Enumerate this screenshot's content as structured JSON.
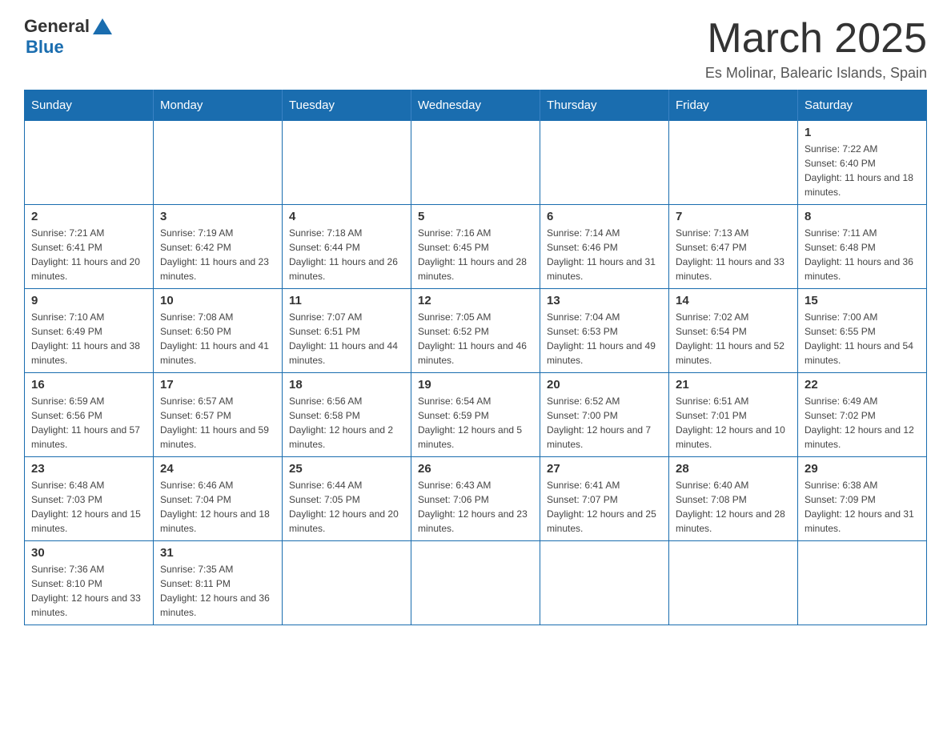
{
  "logo": {
    "general": "General",
    "blue": "Blue"
  },
  "header": {
    "title": "March 2025",
    "location": "Es Molinar, Balearic Islands, Spain"
  },
  "weekdays": [
    "Sunday",
    "Monday",
    "Tuesday",
    "Wednesday",
    "Thursday",
    "Friday",
    "Saturday"
  ],
  "weeks": [
    [
      {
        "day": "",
        "info": ""
      },
      {
        "day": "",
        "info": ""
      },
      {
        "day": "",
        "info": ""
      },
      {
        "day": "",
        "info": ""
      },
      {
        "day": "",
        "info": ""
      },
      {
        "day": "",
        "info": ""
      },
      {
        "day": "1",
        "info": "Sunrise: 7:22 AM\nSunset: 6:40 PM\nDaylight: 11 hours and 18 minutes."
      }
    ],
    [
      {
        "day": "2",
        "info": "Sunrise: 7:21 AM\nSunset: 6:41 PM\nDaylight: 11 hours and 20 minutes."
      },
      {
        "day": "3",
        "info": "Sunrise: 7:19 AM\nSunset: 6:42 PM\nDaylight: 11 hours and 23 minutes."
      },
      {
        "day": "4",
        "info": "Sunrise: 7:18 AM\nSunset: 6:44 PM\nDaylight: 11 hours and 26 minutes."
      },
      {
        "day": "5",
        "info": "Sunrise: 7:16 AM\nSunset: 6:45 PM\nDaylight: 11 hours and 28 minutes."
      },
      {
        "day": "6",
        "info": "Sunrise: 7:14 AM\nSunset: 6:46 PM\nDaylight: 11 hours and 31 minutes."
      },
      {
        "day": "7",
        "info": "Sunrise: 7:13 AM\nSunset: 6:47 PM\nDaylight: 11 hours and 33 minutes."
      },
      {
        "day": "8",
        "info": "Sunrise: 7:11 AM\nSunset: 6:48 PM\nDaylight: 11 hours and 36 minutes."
      }
    ],
    [
      {
        "day": "9",
        "info": "Sunrise: 7:10 AM\nSunset: 6:49 PM\nDaylight: 11 hours and 38 minutes."
      },
      {
        "day": "10",
        "info": "Sunrise: 7:08 AM\nSunset: 6:50 PM\nDaylight: 11 hours and 41 minutes."
      },
      {
        "day": "11",
        "info": "Sunrise: 7:07 AM\nSunset: 6:51 PM\nDaylight: 11 hours and 44 minutes."
      },
      {
        "day": "12",
        "info": "Sunrise: 7:05 AM\nSunset: 6:52 PM\nDaylight: 11 hours and 46 minutes."
      },
      {
        "day": "13",
        "info": "Sunrise: 7:04 AM\nSunset: 6:53 PM\nDaylight: 11 hours and 49 minutes."
      },
      {
        "day": "14",
        "info": "Sunrise: 7:02 AM\nSunset: 6:54 PM\nDaylight: 11 hours and 52 minutes."
      },
      {
        "day": "15",
        "info": "Sunrise: 7:00 AM\nSunset: 6:55 PM\nDaylight: 11 hours and 54 minutes."
      }
    ],
    [
      {
        "day": "16",
        "info": "Sunrise: 6:59 AM\nSunset: 6:56 PM\nDaylight: 11 hours and 57 minutes."
      },
      {
        "day": "17",
        "info": "Sunrise: 6:57 AM\nSunset: 6:57 PM\nDaylight: 11 hours and 59 minutes."
      },
      {
        "day": "18",
        "info": "Sunrise: 6:56 AM\nSunset: 6:58 PM\nDaylight: 12 hours and 2 minutes."
      },
      {
        "day": "19",
        "info": "Sunrise: 6:54 AM\nSunset: 6:59 PM\nDaylight: 12 hours and 5 minutes."
      },
      {
        "day": "20",
        "info": "Sunrise: 6:52 AM\nSunset: 7:00 PM\nDaylight: 12 hours and 7 minutes."
      },
      {
        "day": "21",
        "info": "Sunrise: 6:51 AM\nSunset: 7:01 PM\nDaylight: 12 hours and 10 minutes."
      },
      {
        "day": "22",
        "info": "Sunrise: 6:49 AM\nSunset: 7:02 PM\nDaylight: 12 hours and 12 minutes."
      }
    ],
    [
      {
        "day": "23",
        "info": "Sunrise: 6:48 AM\nSunset: 7:03 PM\nDaylight: 12 hours and 15 minutes."
      },
      {
        "day": "24",
        "info": "Sunrise: 6:46 AM\nSunset: 7:04 PM\nDaylight: 12 hours and 18 minutes."
      },
      {
        "day": "25",
        "info": "Sunrise: 6:44 AM\nSunset: 7:05 PM\nDaylight: 12 hours and 20 minutes."
      },
      {
        "day": "26",
        "info": "Sunrise: 6:43 AM\nSunset: 7:06 PM\nDaylight: 12 hours and 23 minutes."
      },
      {
        "day": "27",
        "info": "Sunrise: 6:41 AM\nSunset: 7:07 PM\nDaylight: 12 hours and 25 minutes."
      },
      {
        "day": "28",
        "info": "Sunrise: 6:40 AM\nSunset: 7:08 PM\nDaylight: 12 hours and 28 minutes."
      },
      {
        "day": "29",
        "info": "Sunrise: 6:38 AM\nSunset: 7:09 PM\nDaylight: 12 hours and 31 minutes."
      }
    ],
    [
      {
        "day": "30",
        "info": "Sunrise: 7:36 AM\nSunset: 8:10 PM\nDaylight: 12 hours and 33 minutes."
      },
      {
        "day": "31",
        "info": "Sunrise: 7:35 AM\nSunset: 8:11 PM\nDaylight: 12 hours and 36 minutes."
      },
      {
        "day": "",
        "info": ""
      },
      {
        "day": "",
        "info": ""
      },
      {
        "day": "",
        "info": ""
      },
      {
        "day": "",
        "info": ""
      },
      {
        "day": "",
        "info": ""
      }
    ]
  ]
}
